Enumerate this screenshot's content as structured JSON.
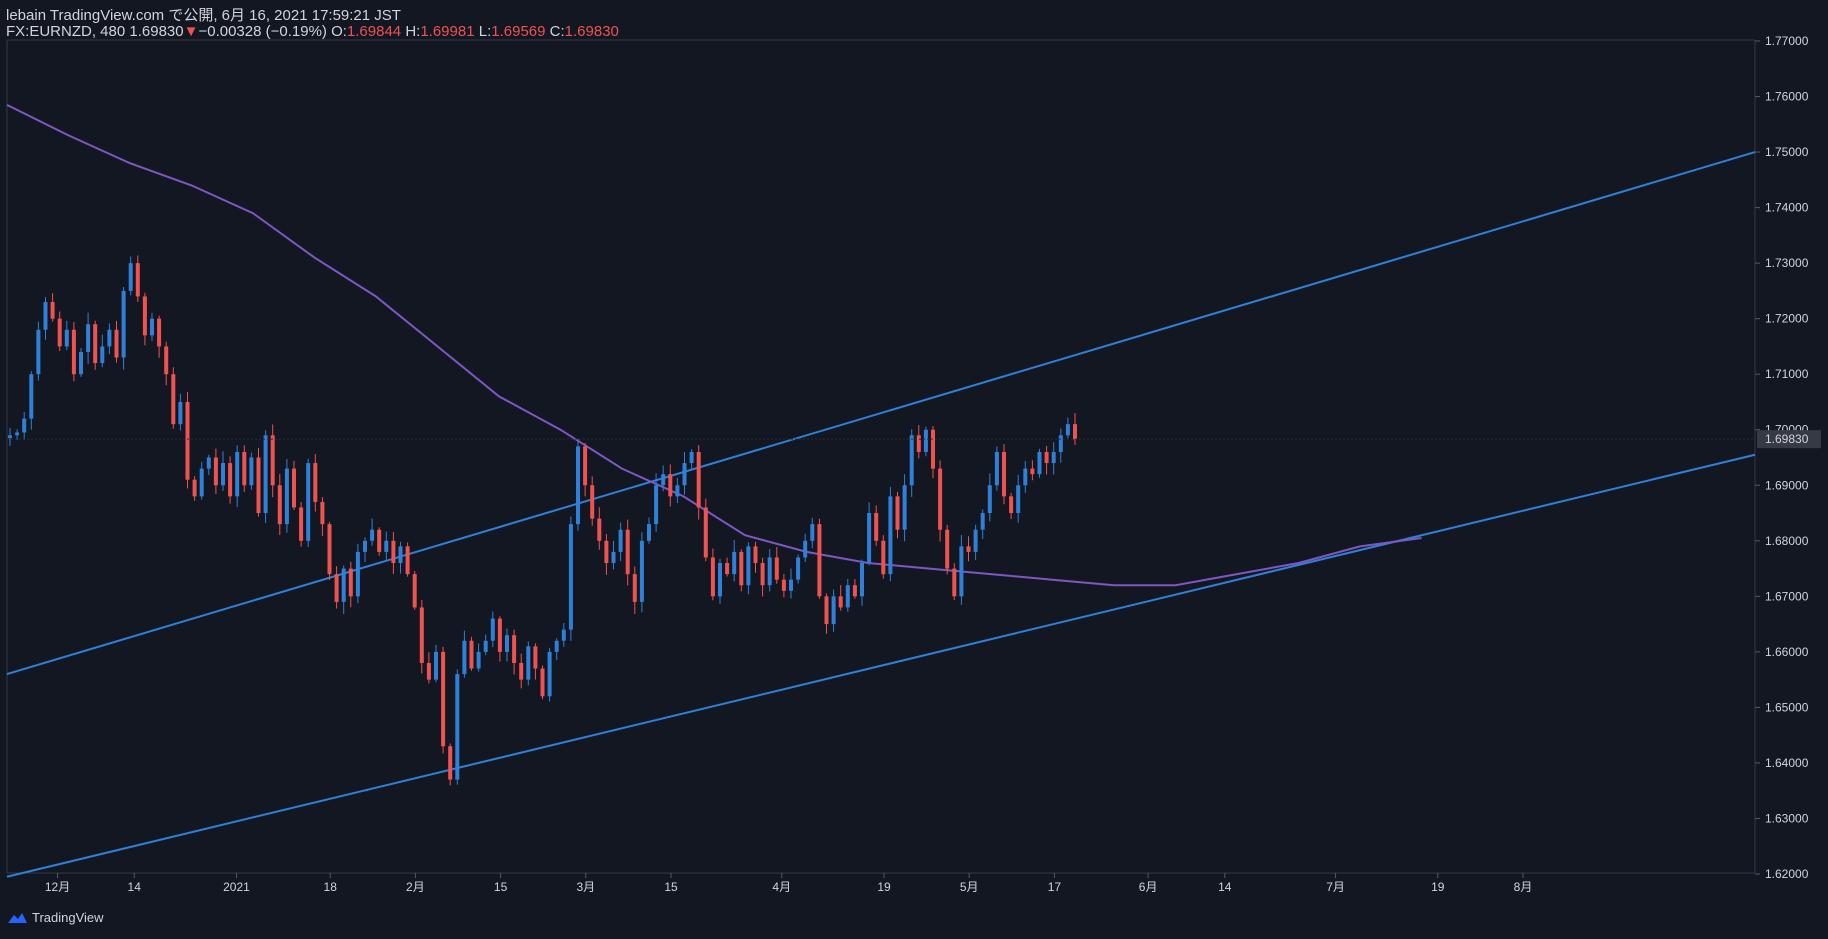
{
  "header": {
    "publisher": "lebain TradingView.com で公開, 6月 16, 2021 17:59:21 JST",
    "symbol": "FX:EURNZD, 480",
    "last": "1.69830",
    "change": "−0.00328 (−0.19%)",
    "o_label": "O:",
    "o_value": "1.69844",
    "h_label": "H:",
    "h_value": "1.69981",
    "l_label": "L:",
    "l_value": "1.69569",
    "c_label": "C:",
    "c_value": "1.69830"
  },
  "footer": {
    "brand": "TradingView"
  },
  "colors": {
    "background": "#131722",
    "up": "#2f80d8",
    "down": "#ef5350",
    "ma": "#7e57c2",
    "trendline": "#2f80d8",
    "text": "#d1d4dc"
  },
  "icons": {
    "brand_logo": "tradingview-cloud-icon",
    "down_arrow": "triangle-down-icon"
  },
  "chart_data": {
    "type": "candlestick",
    "symbol": "FX:EURNZD",
    "timeframe": "480",
    "ylim": [
      1.62,
      1.77
    ],
    "y_ticks": [
      "1.77000",
      "1.76000",
      "1.75000",
      "1.74000",
      "1.73000",
      "1.72000",
      "1.71000",
      "1.70000",
      "1.69000",
      "1.68000",
      "1.67000",
      "1.66000",
      "1.65000",
      "1.64000",
      "1.63000",
      "1.62000"
    ],
    "current_price": "1.69830",
    "x_ticks": [
      "12月",
      "14",
      "2021",
      "18",
      "2月",
      "15",
      "3月",
      "15",
      "4月",
      "19",
      "5月",
      "17",
      "6月",
      "14",
      "7月",
      "19",
      "8月"
    ],
    "x_tick_index": [
      3,
      12,
      24,
      35,
      45,
      55,
      65,
      75,
      88,
      100,
      110,
      120,
      131,
      140,
      153,
      165,
      175
    ],
    "close_path": [
      1.699,
      1.6995,
      1.702,
      1.71,
      1.718,
      1.723,
      1.72,
      1.715,
      1.718,
      1.71,
      1.714,
      1.719,
      1.712,
      1.715,
      1.718,
      1.713,
      1.725,
      1.73,
      1.724,
      1.717,
      1.72,
      1.715,
      1.71,
      1.701,
      1.705,
      1.691,
      1.688,
      1.693,
      1.695,
      1.69,
      1.694,
      1.688,
      1.696,
      1.69,
      1.695,
      1.685,
      1.699,
      1.69,
      1.683,
      1.693,
      1.686,
      1.68,
      1.694,
      1.687,
      1.683,
      1.674,
      1.669,
      1.675,
      1.67,
      1.678,
      1.68,
      1.682,
      1.678,
      1.68,
      1.676,
      1.679,
      1.674,
      1.668,
      1.658,
      1.655,
      1.66,
      1.643,
      1.637,
      1.656,
      1.662,
      1.657,
      1.66,
      1.662,
      1.666,
      1.66,
      1.663,
      1.658,
      1.655,
      1.661,
      1.657,
      1.652,
      1.66,
      1.662,
      1.664,
      1.683,
      1.697,
      1.69,
      1.684,
      1.68,
      1.676,
      1.678,
      1.682,
      1.674,
      1.669,
      1.68,
      1.683,
      1.69,
      1.692,
      1.688,
      1.69,
      1.694,
      1.696,
      1.686,
      1.677,
      1.67,
      1.676,
      1.674,
      1.678,
      1.672,
      1.679,
      1.676,
      1.672,
      1.677,
      1.673,
      1.671,
      1.673,
      1.677,
      1.68,
      1.683,
      1.67,
      1.665,
      1.67,
      1.668,
      1.672,
      1.67,
      1.676,
      1.685,
      1.68,
      1.674,
      1.688,
      1.682,
      1.69,
      1.699,
      1.696,
      1.7,
      1.693,
      1.682,
      1.675,
      1.67,
      1.679,
      1.678,
      1.682,
      1.685,
      1.69,
      1.696,
      1.688,
      1.685,
      1.69,
      1.693,
      1.692,
      1.696,
      1.694,
      1.696,
      1.699,
      1.701,
      1.6983
    ],
    "moving_average": [
      [
        0,
        1.7585
      ],
      [
        10,
        1.753
      ],
      [
        20,
        1.748
      ],
      [
        30,
        1.744
      ],
      [
        40,
        1.739
      ],
      [
        50,
        1.731
      ],
      [
        60,
        1.724
      ],
      [
        70,
        1.715
      ],
      [
        80,
        1.706
      ],
      [
        90,
        1.7
      ],
      [
        100,
        1.693
      ],
      [
        110,
        1.688
      ],
      [
        120,
        1.681
      ],
      [
        130,
        1.678
      ],
      [
        140,
        1.676
      ],
      [
        150,
        1.675
      ],
      [
        160,
        1.674
      ],
      [
        170,
        1.673
      ],
      [
        180,
        1.672
      ],
      [
        190,
        1.672
      ],
      [
        200,
        1.674
      ],
      [
        210,
        1.676
      ],
      [
        220,
        1.679
      ],
      [
        230,
        1.6805
      ]
    ],
    "channel_upper": [
      [
        0,
        1.656
      ],
      [
        260,
        1.75
      ]
    ],
    "channel_lower": [
      [
        0,
        1.6195
      ],
      [
        260,
        1.6955
      ]
    ]
  }
}
